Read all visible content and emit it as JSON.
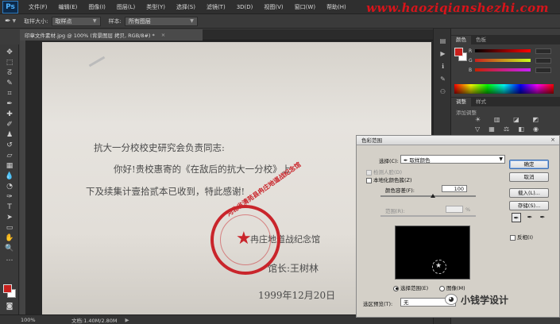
{
  "app": {
    "logo": "Ps",
    "menu": [
      "文件(F)",
      "编辑(E)",
      "图像(I)",
      "图层(L)",
      "类型(Y)",
      "选择(S)",
      "滤镜(T)",
      "3D(D)",
      "视图(V)",
      "窗口(W)",
      "帮助(H)"
    ],
    "watermark_url": "www.haoziqianshezhi.com"
  },
  "options_bar": {
    "sample_size_label": "取样大小:",
    "sample_size_value": "取样点",
    "sample_label": "样本:",
    "sample_value": "所有图层"
  },
  "document": {
    "tab_title": "印章文件素材.jpg @ 100% (背景图层 拷贝, RGB/8#) *",
    "tab_close": "×",
    "lines": [
      "抗大一分校校史研究会负责同志:",
      "你好!贵校惠寄的《在敌后的抗大一分校》上",
      "下及续集计壹拾贰本已收到，特此感谢!"
    ],
    "sign_org": "冉庄地道战纪念馆",
    "sign_name": "馆长:王树林",
    "date": "1999年12月20日",
    "stamp_text": "河北省清苑县冉庄地道战纪念馆",
    "stamp_star": "★"
  },
  "status_bar": {
    "zoom": "100%",
    "doc_info": "文档:1.40M/2.80M"
  },
  "color_panel": {
    "tabs": [
      "颜色",
      "色板"
    ],
    "channels": [
      "R",
      "G",
      "B"
    ]
  },
  "adjust_panel": {
    "tabs": [
      "调整",
      "样式"
    ],
    "subtitle": "添加调整"
  },
  "dialog": {
    "title": "色彩范围",
    "close": "×",
    "select_label": "选择(C):",
    "select_value": "取样颜色",
    "detect_faces": "检测人脸(D)",
    "localized": "本地化颜色簇(Z)",
    "fuzziness_label": "颜色容差(F):",
    "fuzziness_value": "100",
    "range_label": "范围(R):",
    "range_unit": "%",
    "radio_selection": "选择范围(E)",
    "radio_image": "图像(M)",
    "selection_preview_label": "选区预览(T):",
    "selection_preview_value": "无",
    "buttons": {
      "ok": "确定",
      "cancel": "取消",
      "load": "载入(L)...",
      "save": "存储(S)..."
    },
    "invert": "反相(I)"
  },
  "bottom_watermark": "小钱学设计",
  "colors": {
    "accent_red": "#c8201d",
    "stamp_red": "#c9252b"
  }
}
